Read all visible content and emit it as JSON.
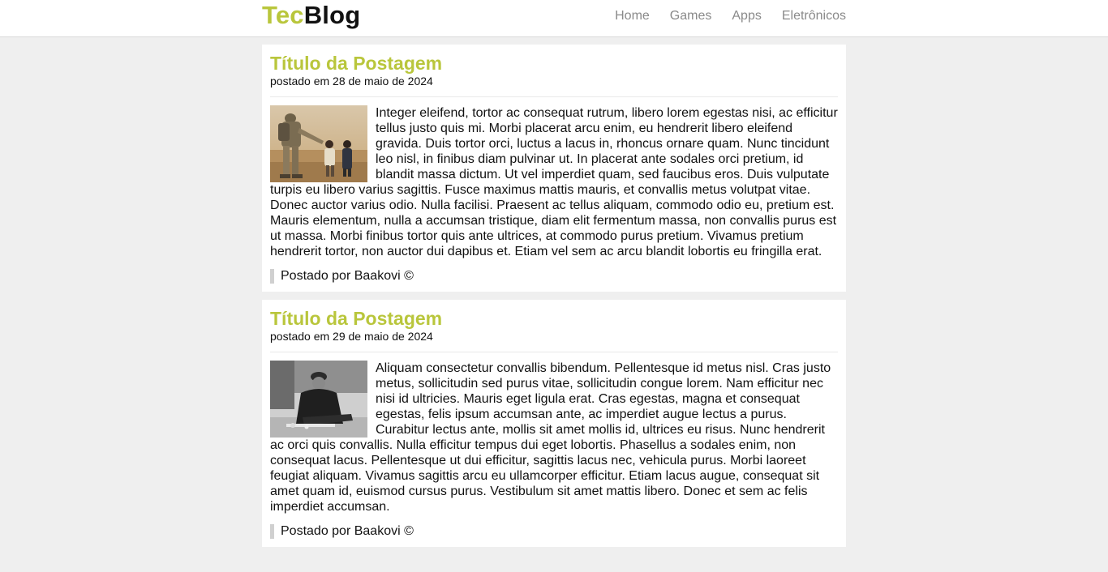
{
  "header": {
    "logo_part1": "Tec",
    "logo_part2": "Blog",
    "nav": [
      {
        "label": "Home"
      },
      {
        "label": "Games"
      },
      {
        "label": "Apps"
      },
      {
        "label": "Eletrônicos"
      }
    ]
  },
  "colors": {
    "accent": "#b9c63c",
    "background": "#efefef",
    "nav_text": "#8a8a8a"
  },
  "posts": [
    {
      "title": "Título da Postagem",
      "date": "postado em 28 de maio de 2024",
      "image_desc": "soldier-and-child-photo",
      "body": "Integer eleifend, tortor ac consequat rutrum, libero lorem egestas nisi, ac efficitur tellus justo quis mi. Morbi placerat arcu enim, eu hendrerit libero eleifend gravida. Duis tortor orci, luctus a lacus in, rhoncus ornare quam. Nunc tincidunt leo nisl, in finibus diam pulvinar ut. In placerat ante sodales orci pretium, id blandit massa dictum. Ut vel imperdiet quam, sed faucibus eros. Duis vulputate turpis eu libero varius sagittis. Fusce maximus mattis mauris, et convallis metus volutpat vitae. Donec auctor varius odio. Nulla facilisi. Praesent ac tellus aliquam, commodo odio eu, pretium est. Mauris elementum, nulla a accumsan tristique, diam elit fermentum massa, non convallis purus est ut massa. Morbi finibus tortor quis ante ultrices, at commodo purus pretium. Vivamus pretium hendrerit tortor, non auctor dui dapibus et. Etiam vel sem ac arcu blandit lobortis eu fringilla erat.",
      "footer": "Postado por Baakovi ©"
    },
    {
      "title": "Título da Postagem",
      "date": "postado em 29 de maio de 2024",
      "image_desc": "elderly-man-photo",
      "body": "Aliquam consectetur convallis bibendum. Pellentesque id metus nisl. Cras justo metus, sollicitudin sed purus vitae, sollicitudin congue lorem. Nam efficitur nec nisi id ultricies. Mauris eget ligula erat. Cras egestas, magna et consequat egestas, felis ipsum accumsan ante, ac imperdiet augue lectus a purus. Curabitur lectus ante, mollis sit amet mollis id, ultrices eu risus. Nunc hendrerit ac orci quis convallis. Nulla efficitur tempus dui eget lobortis. Phasellus a sodales enim, non consequat lacus. Pellentesque ut dui efficitur, sagittis lacus nec, vehicula purus. Morbi laoreet feugiat aliquam. Vivamus sagittis arcu eu ullamcorper efficitur. Etiam lacus augue, consequat sit amet quam id, euismod cursus purus. Vestibulum sit amet mattis libero. Donec et sem ac felis imperdiet accumsan.",
      "footer": "Postado por Baakovi ©"
    }
  ]
}
